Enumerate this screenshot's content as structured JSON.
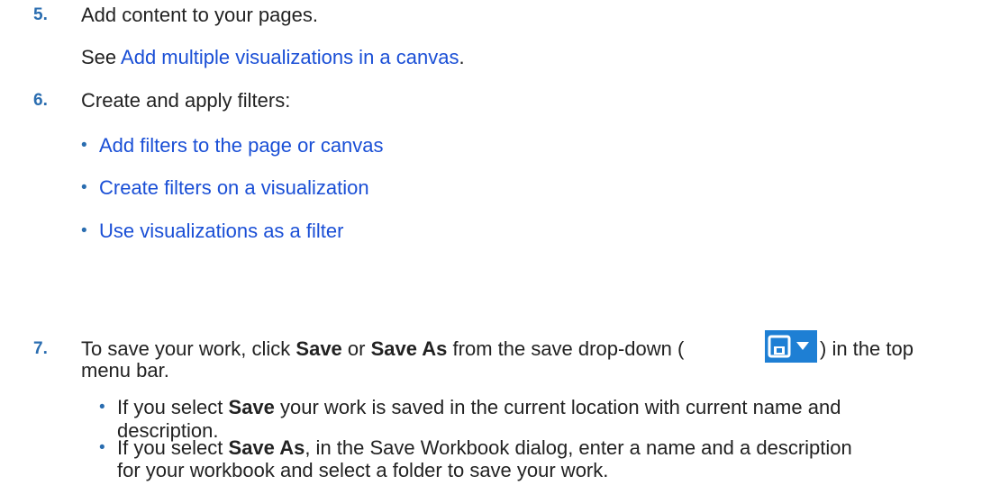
{
  "steps": [
    {
      "number": "5.",
      "text": "Add content to your pages.",
      "see_prefix": "See ",
      "see_link": "Add multiple visualizations in a canvas",
      "see_suffix": "."
    },
    {
      "number": "6.",
      "text": "Create and apply filters:",
      "links": [
        "Add filters to the page or canvas",
        "Create filters on a visualization",
        "Use visualizations as a filter"
      ]
    },
    {
      "number": "7.",
      "text_a": "To save your work, click ",
      "save": "Save",
      "text_or": " or ",
      "save_as": "Save As",
      "text_b": " from the save drop-down (",
      "text_c": ") in the top",
      "text_d": "menu bar.",
      "bullets": [
        {
          "a": "If you select ",
          "bold": "Save",
          "b": " your work is saved in the current location with current name and",
          "c": "description."
        },
        {
          "a": "If you select ",
          "bold": "Save As",
          "b": ", in the Save Workbook dialog, enter a name and a description",
          "c": "for your workbook and select a folder to save your work."
        }
      ]
    }
  ],
  "icons": {
    "bullet": "•",
    "save_icon": "floppy-disk-icon",
    "dropdown_icon": "caret-down-icon"
  },
  "colors": {
    "step_number": "#2a6db0",
    "link": "#1a4fd6",
    "save_button": "#1e7fd4"
  }
}
